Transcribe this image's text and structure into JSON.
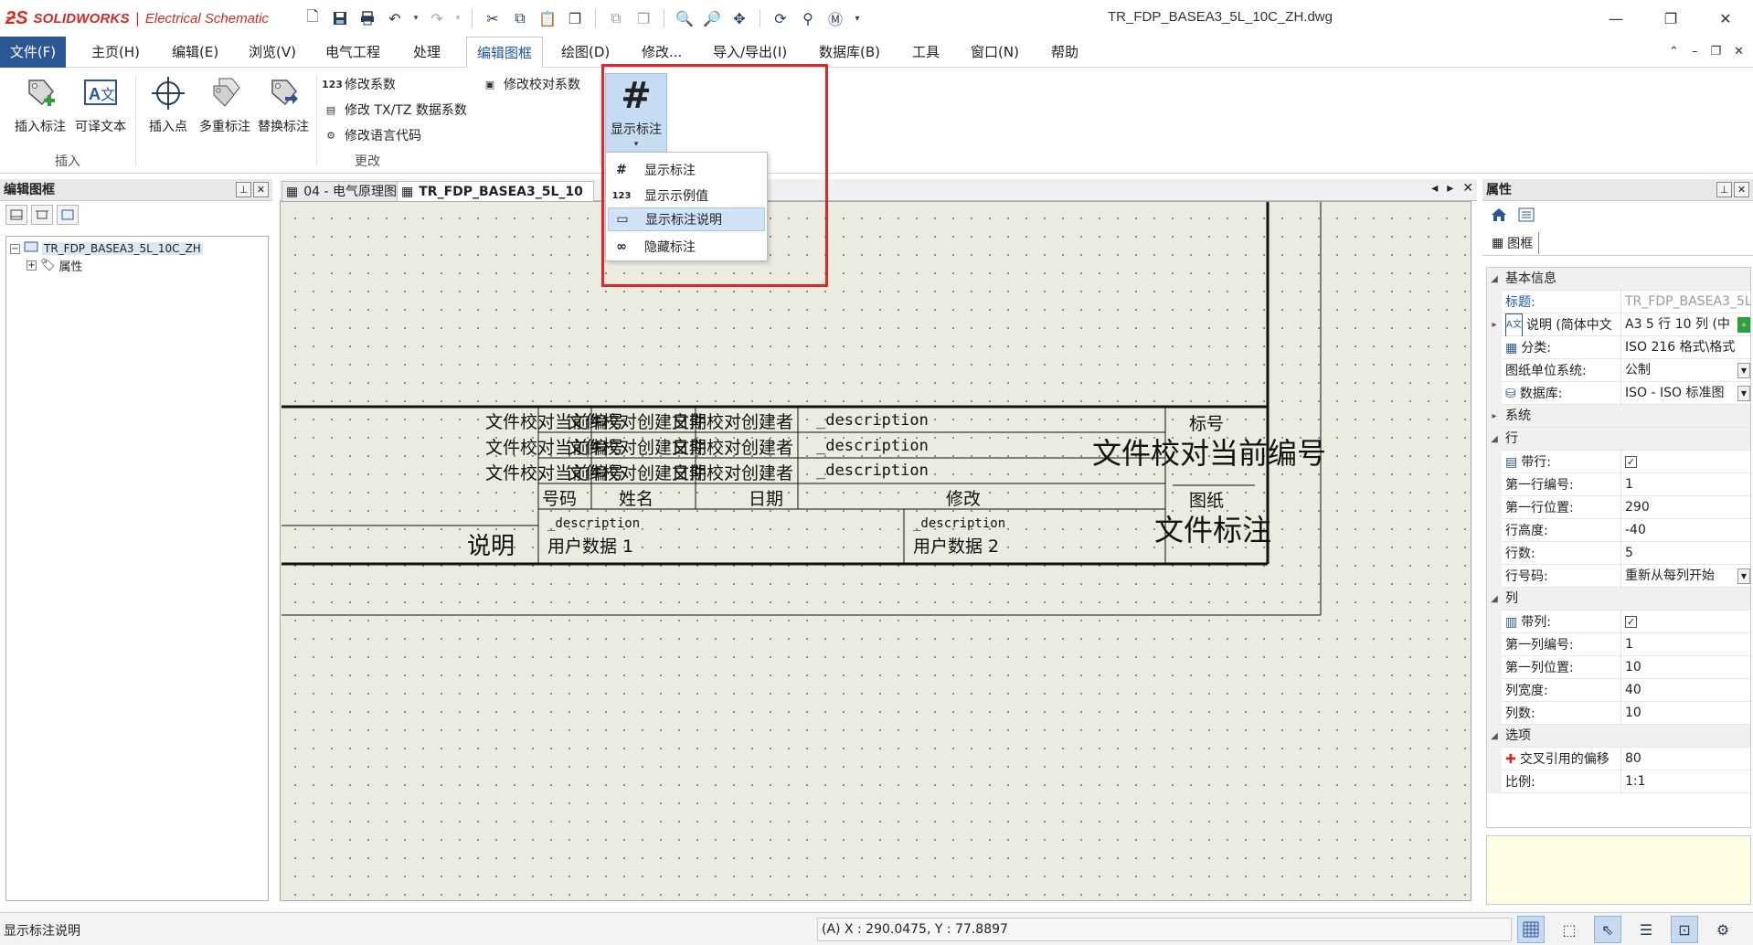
{
  "app": {
    "brand": "SOLIDWORKS",
    "separator": "|",
    "product": "Electrical Schematic",
    "document_title": "TR_FDP_BASEA3_5L_10C_ZH.dwg"
  },
  "quick_access": [
    "new-icon",
    "save-icon",
    "print-icon",
    "undo-icon",
    "redo-icon",
    "cut-icon",
    "copy-icon",
    "paste-icon",
    "duplicate-icon",
    "find-icon",
    "zoom-window-icon",
    "pan-icon",
    "zoom-icon",
    "macro-icon"
  ],
  "menu": {
    "file": "文件(F)",
    "tabs": [
      "主页(H)",
      "编辑(E)",
      "浏览(V)",
      "电气工程",
      "处理",
      "编辑图框",
      "绘图(D)",
      "修改...",
      "导入/导出(I)",
      "数据库(B)",
      "工具",
      "窗口(N)",
      "帮助"
    ],
    "active_tab": "编辑图框"
  },
  "ribbon": {
    "insert_annotation": "插入标注",
    "translatable_text": "可译文本",
    "insert_point": "插入点",
    "multi_annotation": "多重标注",
    "replace_annotation": "替换标注",
    "group_insert": "插入",
    "modify_coefficient": "修改系数",
    "modify_txtz": "修改 TX/TZ 数据系数",
    "modify_language": "修改语言代码",
    "modify_check_coefficient": "修改校对系数",
    "group_change": "更改",
    "show_annotation": "显示标注",
    "coefficient_icon_text": "123"
  },
  "dropdown": {
    "items": [
      {
        "icon": "#",
        "label": "显示标注"
      },
      {
        "icon": "123",
        "label": "显示示例值"
      },
      {
        "icon": "▭",
        "label": "显示标注说明"
      },
      {
        "icon": "∞",
        "label": "隐藏标注"
      }
    ],
    "highlighted": "显示标注说明"
  },
  "left_panel": {
    "title": "编辑图框",
    "tree_root": "TR_FDP_BASEA3_5L_10C_ZH",
    "tree_child": "属性"
  },
  "doc_tabs": [
    {
      "label": "04 - 电气原理图"
    },
    {
      "label": "TR_FDP_BASEA3_5L_10"
    }
  ],
  "drawing": {
    "row_texts": [
      {
        "a": "文件校对当前编号",
        "b": "文件校对创建日期",
        "c": "文件校对创建者",
        "d": "_description"
      },
      {
        "a": "文件校对当前编号",
        "b": "文件校对创建日期",
        "c": "文件校对创建者",
        "d": "_description"
      },
      {
        "a": "文件校对当前编号",
        "b": "文件校对创建日期",
        "c": "文件校对创建者",
        "d": "_description"
      }
    ],
    "header": {
      "number": "号码",
      "name": "姓名",
      "date": "日期",
      "modify": "修改"
    },
    "description_label": "说明",
    "user_data_1_desc": "_description",
    "user_data_1": "用户数据 1",
    "user_data_2_desc": "_description",
    "user_data_2": "用户数据 2",
    "mark_label": "标号",
    "current_number": "文件校对当前编号",
    "frame_label": "图纸",
    "file_annotation": "文件标注"
  },
  "properties": {
    "title": "属性",
    "tab": "图框",
    "categories": {
      "basic": "基本信息",
      "system": "系统",
      "row": "行",
      "column": "列",
      "options": "选项"
    },
    "basic": [
      {
        "name": "标题:",
        "value": "TR_FDP_BASEA3_5L"
      },
      {
        "name": "说明 (简体中文",
        "value": "A3 5 行 10 列 (中"
      },
      {
        "name": "分类:",
        "value": "ISO 216 格式\\格式"
      },
      {
        "name": "图纸单位系统:",
        "value": "公制"
      },
      {
        "name": "数据库:",
        "value": "ISO - ISO 标准图"
      }
    ],
    "row": [
      {
        "name": "带行:",
        "value": "✓"
      },
      {
        "name": "第一行编号:",
        "value": "1"
      },
      {
        "name": "第一行位置:",
        "value": "290"
      },
      {
        "name": "行高度:",
        "value": "-40"
      },
      {
        "name": "行数:",
        "value": "5"
      },
      {
        "name": "行号码:",
        "value": "重新从每列开始"
      }
    ],
    "column": [
      {
        "name": "带列:",
        "value": "✓"
      },
      {
        "name": "第一列编号:",
        "value": "1"
      },
      {
        "name": "第一列位置:",
        "value": "10"
      },
      {
        "name": "列宽度:",
        "value": "40"
      },
      {
        "name": "列数:",
        "value": "10"
      }
    ],
    "options": [
      {
        "name": "交叉引用的偏移",
        "value": "80"
      },
      {
        "name": "比例:",
        "value": "1:1"
      }
    ]
  },
  "status": {
    "hint": "显示标注说明",
    "coords": "(A) X : 290.0475, Y : 77.8897"
  },
  "colors": {
    "accent": "#2b5797",
    "highlight": "#e0262b",
    "canvas": "#ecebe0",
    "brand": "#d52b1e"
  }
}
